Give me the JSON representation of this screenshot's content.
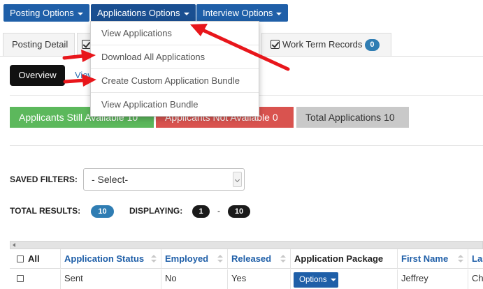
{
  "top_buttons": {
    "posting_options": "Posting Options",
    "applications_options": "Applications Options",
    "interview_options": "Interview Options"
  },
  "dropdown_menu": {
    "items": [
      "View Applications",
      "Download All Applications",
      "Create Custom Application Bundle",
      "View Application Bundle"
    ]
  },
  "tabs": {
    "posting_detail": "Posting Detail",
    "work_term_records": "Work Term Records",
    "work_term_count": "0"
  },
  "overview": {
    "button": "Overview",
    "view_link": "View"
  },
  "status_bars": {
    "still_available": "Applicants Still Available 10",
    "not_available": "Applicants Not Available 0",
    "total": "Total Applications 10"
  },
  "filters": {
    "label": "SAVED FILTERS:",
    "selected": "- Select-"
  },
  "results": {
    "total_label": "TOTAL RESULTS:",
    "total_value": "10",
    "displaying_label": "DISPLAYING:",
    "from": "1",
    "separator": "-",
    "to": "10"
  },
  "table": {
    "headers": {
      "all": "All",
      "application_status": "Application Status",
      "employed": "Employed",
      "released": "Released",
      "application_package": "Application Package",
      "first_name": "First Name",
      "last_name": "Las"
    },
    "rows": [
      {
        "application_status": "Sent",
        "employed": "No",
        "released": "Yes",
        "package_button": "Options",
        "first_name": "Jeffrey",
        "last_name": "Che"
      }
    ]
  },
  "colors": {
    "primary_blue": "#1f5fa8",
    "green": "#5cb85c",
    "red": "#d9534f",
    "grey": "#c9c9c9",
    "badge_blue": "#2f7db3",
    "annotation_red": "#e8161b"
  }
}
